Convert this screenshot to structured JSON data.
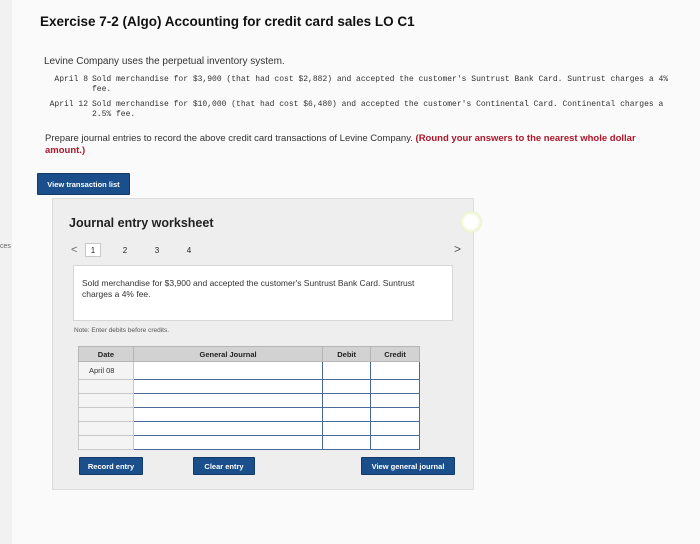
{
  "side_label": "ces",
  "title": "Exercise 7-2 (Algo) Accounting for credit card sales LO C1",
  "intro": "Levine Company uses the perpetual inventory system.",
  "transactions": [
    {
      "date": "April  8",
      "text": "Sold merchandise for $3,900 (that had cost $2,882) and accepted the customer's Suntrust Bank Card. Suntrust charges a 4% fee."
    },
    {
      "date": "April 12",
      "text": "Sold merchandise for $10,000 (that had cost $6,480) and accepted the customer's Continental Card. Continental charges a 2.5% fee."
    }
  ],
  "instruction": "Prepare journal entries to record the above credit card transactions of Levine Company.",
  "instruction_emphasis": "(Round your answers to the nearest whole dollar amount.)",
  "view_transaction_list": "View transaction list",
  "worksheet": {
    "title": "Journal entry worksheet",
    "prev_symbol": "<",
    "next_symbol": ">",
    "pages": [
      "1",
      "2",
      "3",
      "4"
    ],
    "active_page": "1",
    "description": "Sold merchandise for $3,900 and accepted the customer's Suntrust Bank Card. Suntrust charges a 4% fee.",
    "note": "Note: Enter debits before credits.",
    "columns": {
      "date": "Date",
      "account": "General Journal",
      "debit": "Debit",
      "credit": "Credit"
    },
    "rows": [
      {
        "date": "April 08",
        "account": "",
        "debit": "",
        "credit": ""
      },
      {
        "date": "",
        "account": "",
        "debit": "",
        "credit": ""
      },
      {
        "date": "",
        "account": "",
        "debit": "",
        "credit": ""
      },
      {
        "date": "",
        "account": "",
        "debit": "",
        "credit": ""
      },
      {
        "date": "",
        "account": "",
        "debit": "",
        "credit": ""
      },
      {
        "date": "",
        "account": "",
        "debit": "",
        "credit": ""
      }
    ],
    "record_entry": "Record entry",
    "clear_entry": "Clear entry",
    "view_general_journal": "View general journal"
  },
  "colors": {
    "button_blue": "#1a4f8c",
    "emphasis_red": "#b0152a"
  }
}
